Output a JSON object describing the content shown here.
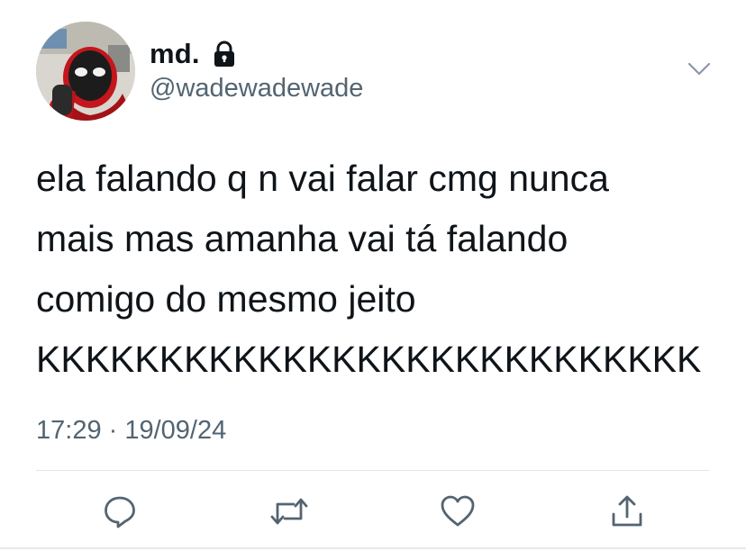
{
  "user": {
    "display_name": "md.",
    "handle": "@wadewadewade",
    "protected_icon": "lock-icon"
  },
  "tweet": {
    "lines": [
      "ela falando q n vai falar cmg nunca",
      "mais mas amanha vai tá falando",
      "comigo do mesmo jeito",
      "KKKKKKKKKKKKKKKKKKKKKKKKKKK"
    ],
    "timestamp": "17:29 · 19/09/24"
  },
  "actions": [
    {
      "name": "reply-icon"
    },
    {
      "name": "retweet-icon"
    },
    {
      "name": "like-icon"
    },
    {
      "name": "share-icon"
    }
  ],
  "colors": {
    "text": "#0f1419",
    "secondary": "#536471",
    "icon": "#536471",
    "divider": "#e1e6ea"
  }
}
